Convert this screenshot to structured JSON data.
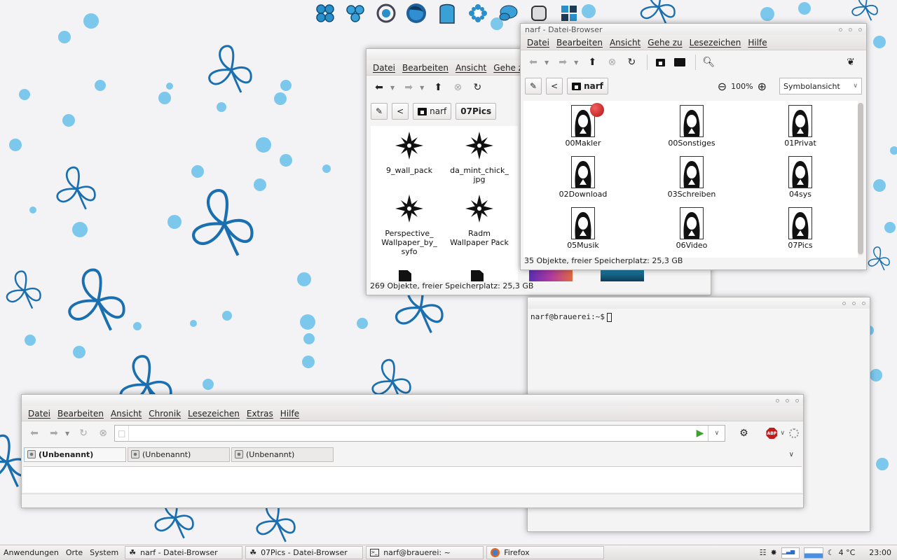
{
  "dock": {
    "icons": [
      "clover-icon",
      "trefoil-icon",
      "target-icon",
      "firefox-icon",
      "tab-icon",
      "flower-icon",
      "chat-icon",
      "square-icon",
      "tiles-icon"
    ]
  },
  "win07pics": {
    "menu": [
      "Datei",
      "Bearbeiten",
      "Ansicht",
      "Gehe zu"
    ],
    "path": [
      "narf",
      "07Pics"
    ],
    "items": [
      {
        "label": "9_wall_pack"
      },
      {
        "label": "da_mint_chick_\njpg"
      },
      {
        "label": "Perspective_\nWallpaper_by_\nsyfo"
      },
      {
        "label": "Radm\nWallpaper Pack"
      }
    ],
    "status": "269 Objekte, freier Speicherplatz: 25,3 GB"
  },
  "winnarf": {
    "title": "narf - Datei-Browser",
    "menu": [
      "Datei",
      "Bearbeiten",
      "Ansicht",
      "Gehe zu",
      "Lesezeichen",
      "Hilfe"
    ],
    "path": "narf",
    "zoom": "100%",
    "view": "Symbolansicht",
    "items": [
      "00Makler",
      "00Sonstiges",
      "01Privat",
      "02Download",
      "03Schreiben",
      "04sys",
      "05Musik",
      "06Video",
      "07Pics"
    ],
    "status": "35 Objekte, freier Speicherplatz: 25,3 GB"
  },
  "terminal": {
    "prompt": "narf@brauerei:~$"
  },
  "firefox": {
    "menu": [
      "Datei",
      "Bearbeiten",
      "Ansicht",
      "Chronik",
      "Lesezeichen",
      "Extras",
      "Hilfe"
    ],
    "tabs": [
      "(Unbenannt)",
      "(Unbenannt)",
      "(Unbenannt)"
    ],
    "url": "",
    "abp": "ABP"
  },
  "taskbar": {
    "menus": [
      "Anwendungen",
      "Orte",
      "System"
    ],
    "tasks": [
      "narf - Datei-Browser",
      "07Pics - Datei-Browser",
      "narf@brauerei: ~",
      "Firefox"
    ],
    "temp": "4 °C",
    "clock": "23:00"
  }
}
